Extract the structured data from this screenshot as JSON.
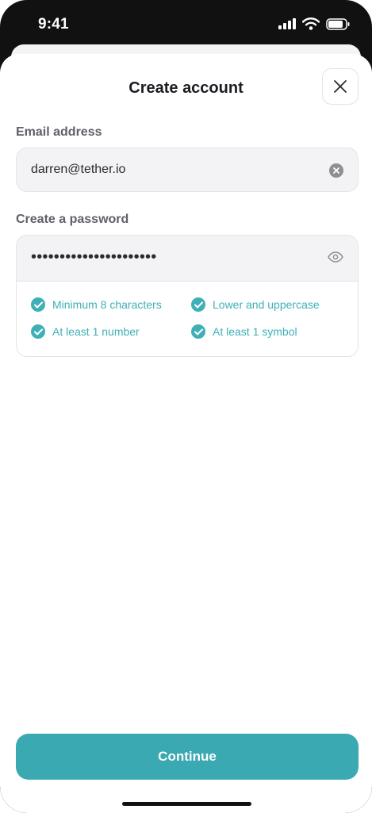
{
  "status_bar": {
    "time": "9:41"
  },
  "header": {
    "title": "Create account"
  },
  "email": {
    "label": "Email address",
    "value": "darren@tether.io"
  },
  "password": {
    "label": "Create a password",
    "value": "••••••••••••••••••••••",
    "requirements": [
      {
        "label": "Minimum 8 characters",
        "met": true
      },
      {
        "label": "Lower and uppercase",
        "met": true
      },
      {
        "label": "At least 1 number",
        "met": true
      },
      {
        "label": "At least 1 symbol",
        "met": true
      }
    ]
  },
  "footer": {
    "continue_label": "Continue"
  },
  "colors": {
    "accent": "#3aa9b1",
    "check": "#3eb0b6",
    "field_bg": "#f3f3f6"
  },
  "icons": [
    "signal-icon",
    "wifi-icon",
    "battery-icon",
    "close-icon",
    "clear-icon",
    "eye-icon",
    "check-icon"
  ]
}
